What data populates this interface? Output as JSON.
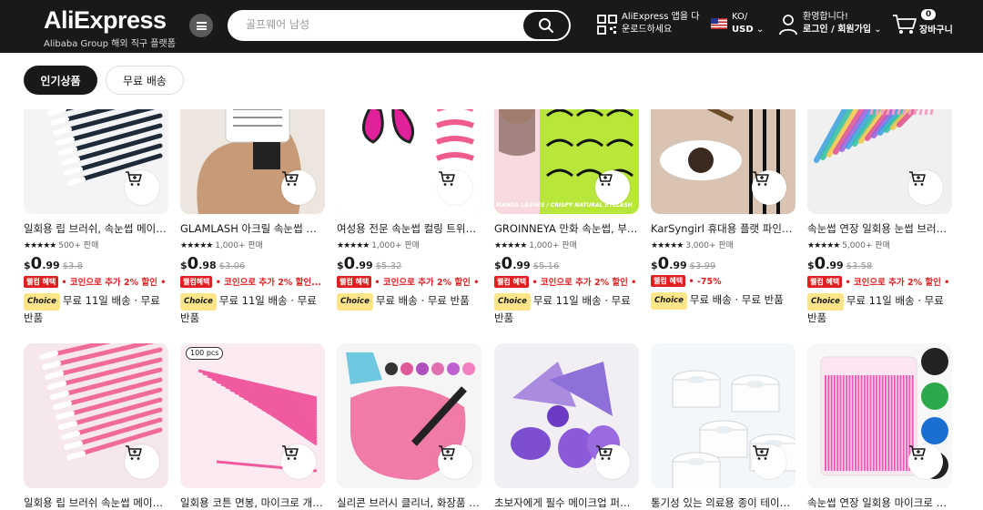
{
  "header": {
    "logo": "AliExpress",
    "logo_sub": "Alibaba Group 해외 직구 플랫폼",
    "search_placeholder": "골프웨어 남성",
    "app_line1": "AliExpress 앱을 다",
    "app_line2": "운로드하세요",
    "lang_line1": "KO/",
    "lang_line2": "USD",
    "account_line1": "환영합니다!",
    "account_line2": "로그인 / 회원가입",
    "cart_count": "0",
    "cart_label": "장바구니",
    "bg_color": "#191919"
  },
  "tabs": [
    {
      "label": "인기상품",
      "active": true
    },
    {
      "label": "무료 배송",
      "active": false
    }
  ],
  "products_row1": [
    {
      "title": "일회용 립 브러쉬, 속눈썹 메이크업 브러쉬",
      "stars": "★★★★★",
      "sold": "500+ 판매",
      "price_cur": "$",
      "price_int": "0",
      "price_cent": ".99",
      "price_old": "$3.8",
      "promo_badge": "웰컴 혜택",
      "promo_text": "• 코인으로 추가 2% 할인 • ...",
      "ship": "무료 11일 배송 · 무료 반품",
      "icon": "lip-brush-black"
    },
    {
      "title": "GLAMLASH 아크릴 속눈썹 익스텐션 팔레트",
      "stars": "★★★★★",
      "sold": "1,000+ 판매",
      "price_cur": "$",
      "price_int": "0",
      "price_cent": ".98",
      "price_old": "$3.06",
      "promo_badge": "웰컴혜택",
      "promo_text": "• 코인으로 추가 2% 할인...",
      "ship": "무료 11일 배송 · 무료 반품",
      "icon": "lash-palette"
    },
    {
      "title": "여성용 전문 속눈썹 컬링 트위저 세트",
      "stars": "★★★★★",
      "sold": "1,000+ 판매",
      "price_cur": "$",
      "price_int": "0",
      "price_cent": ".99",
      "price_old": "$5.32",
      "promo_badge": "웰컴 혜택",
      "promo_text": "• 코인으로 추가 2% 할인 • ...",
      "ship": "무료 배송 · 무료 반품",
      "icon": "eyelash-curler"
    },
    {
      "title": "GROINNEYA 만화 속눈썹, 부드러운 인조 속눈썹",
      "stars": "★★★★★",
      "sold": "1,000+ 판매",
      "price_cur": "$",
      "price_int": "0",
      "price_cent": ".99",
      "price_old": "$5.16",
      "promo_badge": "웰컴 혜택",
      "promo_text": "• 코인으로 추가 2% 할인 • ...",
      "ship": "무료 11일 배송 · 무료 반품",
      "icon": "false-lashes",
      "overlay": "MANGA LASHES / CRISPY NATURAL EYELASH"
    },
    {
      "title": "KarSyngirl 휴대용 플랫 파인 아이라이너 브러쉬",
      "stars": "★★★★★",
      "sold": "3,000+ 판매",
      "price_cur": "$",
      "price_int": "0",
      "price_cent": ".99",
      "price_old": "$3.99",
      "promo_badge": "웰컴 혜택",
      "promo_text": "• -75%",
      "ship": "무료 배송 · 무료 반품",
      "icon": "eyeliner-brush"
    },
    {
      "title": "속눈썹 연장 일회용 눈썹 브러시, 마스카라",
      "stars": "★★★★★",
      "sold": "5,000+ 판매",
      "price_cur": "$",
      "price_int": "0",
      "price_cent": ".99",
      "price_old": "$3.58",
      "promo_badge": "웰컴 혜택",
      "promo_text": "• 코인으로 추가 2% 할인 • ...",
      "ship": "무료 11일 배송 · 무료 반품",
      "icon": "mascara-wands"
    }
  ],
  "products_row2": [
    {
      "title": "일회용 립 브러쉬 속눈썹 메이크업 브러쉬",
      "icon": "lip-brush-pink"
    },
    {
      "title": "일회용 코튼 면봉, 마이크로 개별 브러쉬",
      "icon": "pink-swabs",
      "badge": "100 pcs"
    },
    {
      "title": "실리콘 브러시 클리너, 화장품 메이크업",
      "icon": "brush-cleaner"
    },
    {
      "title": "초보자에게 필수 메이크업 퍼프 스펀지",
      "icon": "makeup-puffs"
    },
    {
      "title": "통기성 있는 의료용 종이 테이프, 속눈썹",
      "icon": "paper-tape"
    },
    {
      "title": "속눈썹 연장 일회용 마이크로 브러쉬",
      "icon": "micro-brushes"
    }
  ],
  "choice_label": "Choice",
  "colors": {
    "promo_red": "#e02020",
    "choice_yellow": "#fde68a",
    "dark": "#191919"
  }
}
